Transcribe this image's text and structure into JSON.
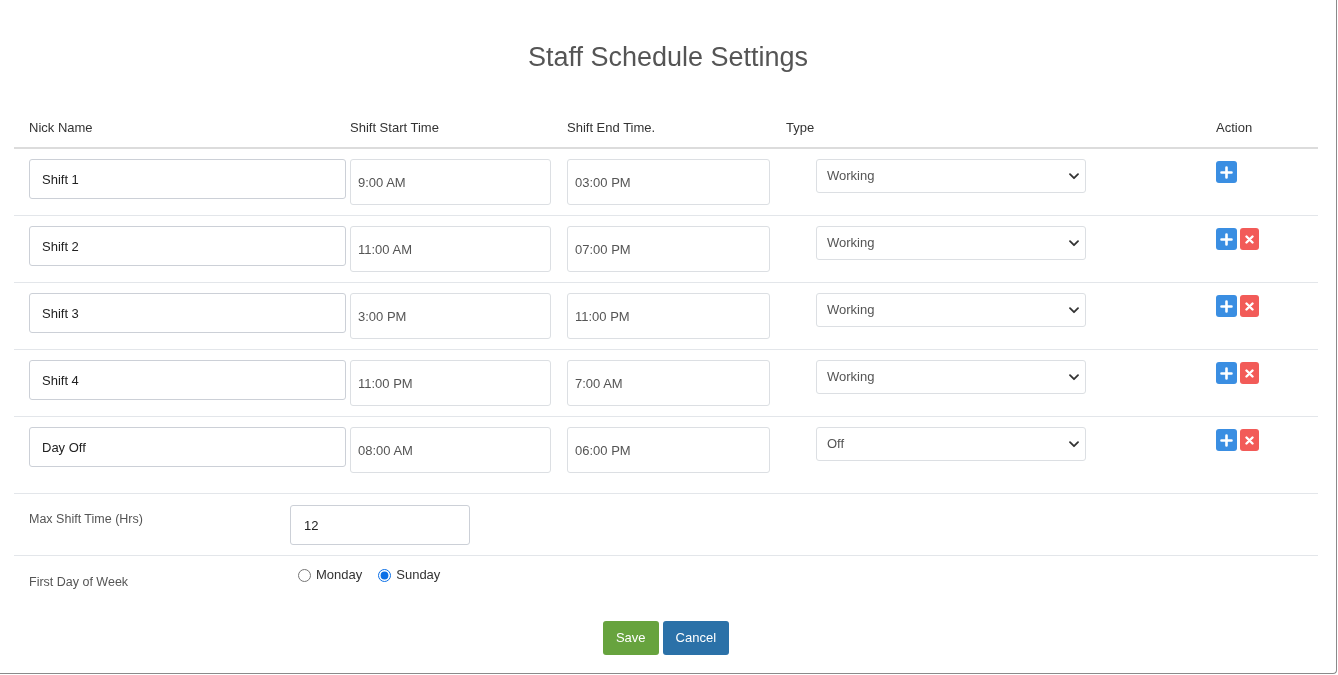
{
  "title": "Staff Schedule Settings",
  "table": {
    "columns": [
      "Nick Name",
      "Shift Start Time",
      "Shift End Time.",
      "Type",
      "Action"
    ],
    "rows": [
      {
        "nick_name": "Shift 1",
        "start_time": "9:00 AM",
        "end_time": "03:00 PM",
        "type": "Working",
        "removable": false
      },
      {
        "nick_name": "Shift 2",
        "start_time": "11:00 AM",
        "end_time": "07:00 PM",
        "type": "Working",
        "removable": true
      },
      {
        "nick_name": "Shift 3",
        "start_time": "3:00 PM",
        "end_time": "11:00 PM",
        "type": "Working",
        "removable": true
      },
      {
        "nick_name": "Shift 4",
        "start_time": "11:00 PM",
        "end_time": "7:00 AM",
        "type": "Working",
        "removable": true
      },
      {
        "nick_name": "Day Off",
        "start_time": "08:00 AM",
        "end_time": "06:00 PM",
        "type": "Off",
        "removable": true
      }
    ]
  },
  "max_shift_time": {
    "label": "Max Shift Time (Hrs)",
    "value": "12"
  },
  "first_day_of_week": {
    "label": "First Day of Week",
    "options": [
      {
        "label": "Monday",
        "selected": false
      },
      {
        "label": "Sunday",
        "selected": true
      }
    ]
  },
  "buttons": [
    {
      "label": "Save",
      "kind": "save"
    },
    {
      "label": "Cancel",
      "kind": "cancel"
    }
  ]
}
